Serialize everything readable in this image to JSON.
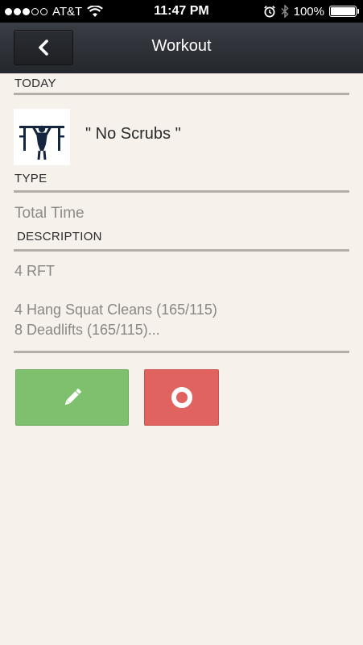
{
  "status_bar": {
    "carrier": "AT&T",
    "time": "11:47 PM",
    "battery_percent": "100%",
    "battery_level": 1.0,
    "signal_bars_filled": 3,
    "signal_bars_total": 5
  },
  "nav": {
    "title": "Workout",
    "back_icon": "chevron-left-icon"
  },
  "sections": {
    "today_label": "TODAY",
    "type_label": "TYPE",
    "description_label": "DESCRIPTION"
  },
  "workout": {
    "name": "\" No Scrubs \"",
    "type": "Total Time",
    "description_lines": [
      "4 RFT",
      "4 Hang Squat Cleans (165/115)",
      "8 Deadlifts (165/115)..."
    ]
  },
  "actions": {
    "edit_icon": "pencil-icon",
    "record_icon": "record-icon",
    "edit_color": "#7ec06e",
    "record_color": "#e0635f"
  }
}
